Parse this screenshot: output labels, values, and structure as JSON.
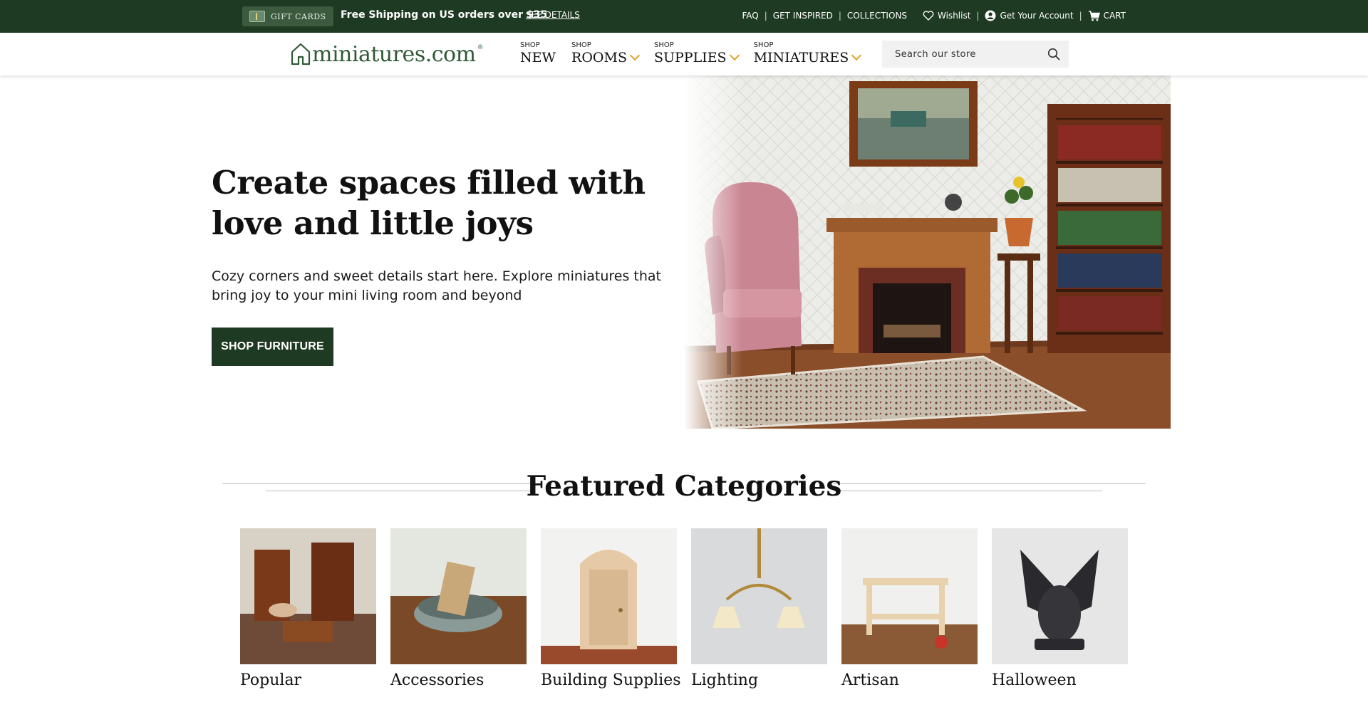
{
  "topbar": {
    "gift_cards_label": "GIFT CARDS",
    "promo_text": "Free Shipping on US orders over $35",
    "details_link": "SEE DETAILS",
    "links": {
      "faq": "FAQ",
      "get_inspired": "GET INSPIRED",
      "collections": "COLLECTIONS",
      "wishlist": "Wishlist",
      "account": "Get Your Account",
      "cart": "CART"
    }
  },
  "header": {
    "logo_text": "miniatures.com",
    "logo_mark": "®",
    "nav": [
      {
        "prefix": "SHOP",
        "label": "NEW"
      },
      {
        "prefix": "SHOP",
        "label": "ROOMS"
      },
      {
        "prefix": "SHOP",
        "label": "SUPPLIES"
      },
      {
        "prefix": "SHOP",
        "label": "MINIATURES"
      }
    ],
    "search_placeholder": "Search our store"
  },
  "hero": {
    "title": "Create spaces filled with love and little joys",
    "subtitle": "Cozy corners and sweet details start here. Explore miniatures that bring joy to your mini living room and beyond",
    "button": "SHOP FURNITURE"
  },
  "featured": {
    "title": "Featured Categories",
    "categories": [
      {
        "name": "Popular"
      },
      {
        "name": "Accessories"
      },
      {
        "name": "Building Supplies"
      },
      {
        "name": "Lighting"
      },
      {
        "name": "Artisan"
      },
      {
        "name": "Halloween"
      }
    ]
  },
  "colors": {
    "brand_green": "#1f3a22",
    "accent_gold": "#e0a22a",
    "logo_green": "#2f5a36"
  },
  "icons": [
    "gift-card-icon",
    "heart-icon",
    "account-icon",
    "cart-icon",
    "house-logo-icon",
    "chevron-down-icon",
    "search-icon"
  ]
}
